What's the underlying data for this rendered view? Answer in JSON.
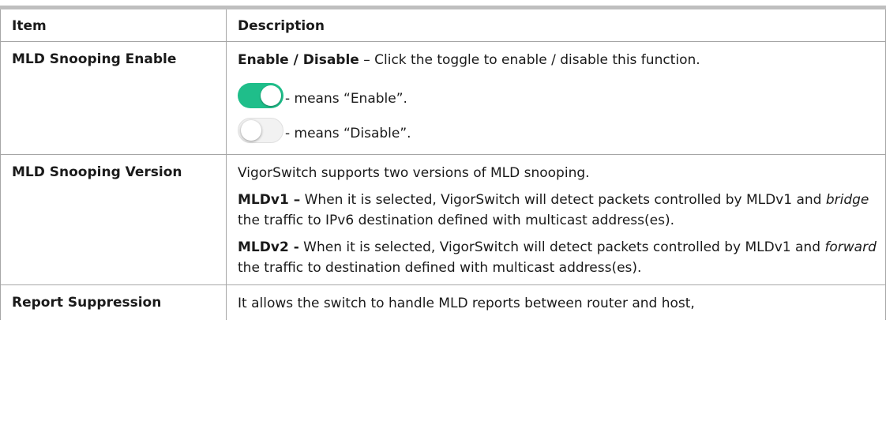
{
  "table": {
    "header": {
      "item": "Item",
      "description": "Description"
    },
    "rows": {
      "enable": {
        "item": "MLD Snooping Enable",
        "p1_bold": "Enable / Disable",
        "p1_text": " – Click the toggle to enable / disable this function.",
        "toggle_on_text": " - means “Enable”.",
        "toggle_off_text": " - means “Disable”."
      },
      "version": {
        "item": "MLD Snooping Version",
        "p1": "VigorSwitch supports two versions of MLD snooping.",
        "v1_bold": "MLDv1 –",
        "v1_a": " When it is selected, VigorSwitch will detect packets controlled by MLDv1 and ",
        "v1_italic": "bridge",
        "v1_b": " the traffic to IPv6 destination defined with multicast address(es).",
        "v2_bold": "MLDv2 -",
        "v2_a": " When it is selected, VigorSwitch will detect packets controlled by MLDv1 and ",
        "v2_italic": "forward",
        "v2_b": " the traffic to destination defined with multicast address(es)."
      },
      "report": {
        "item": "Report Suppression",
        "p1": "It allows the switch to handle MLD reports between router and host,"
      }
    }
  },
  "colors": {
    "toggle_on": "#1fbe8a",
    "toggle_off": "#f2f2f2",
    "border": "#a6a6a6"
  }
}
